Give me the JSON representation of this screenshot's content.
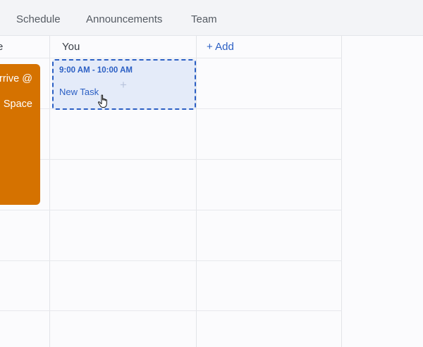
{
  "tabs": [
    {
      "label": "Schedule"
    },
    {
      "label": "Announcements"
    },
    {
      "label": "Team"
    }
  ],
  "columns": {
    "truncated_label": "e",
    "you_label": "You",
    "add_label": "+ Add"
  },
  "orange_event": {
    "line1": "rrive @",
    "line2": "Space",
    "color": "#d57200"
  },
  "new_task": {
    "time": "9:00 AM - 10:00 AM",
    "name": "New Task",
    "accent": "#2b5fc4",
    "fill": "#e4ebf9"
  },
  "icons": {
    "add": "plus-icon",
    "pointer": "hand-pointer-icon"
  }
}
